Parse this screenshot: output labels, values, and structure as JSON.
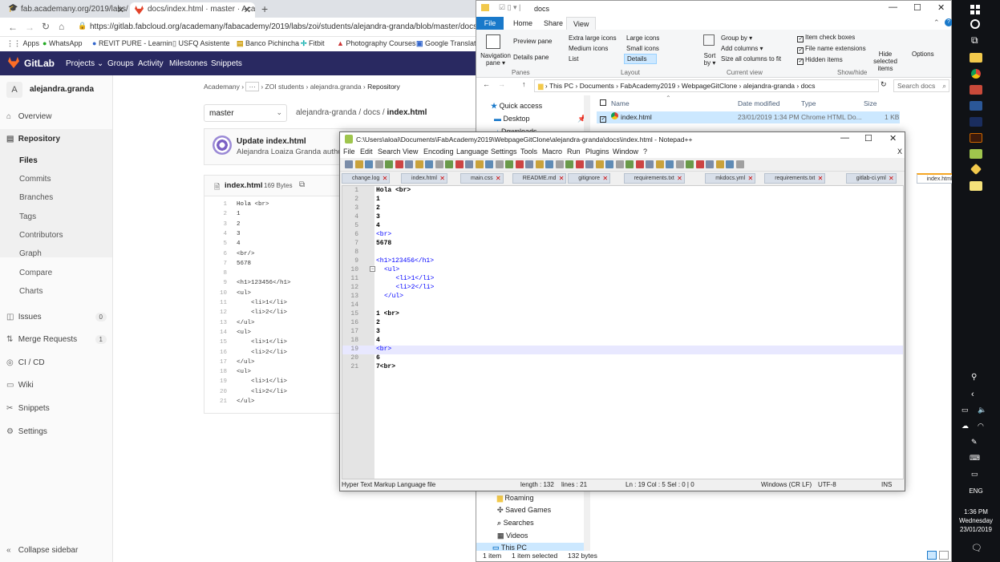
{
  "chrome": {
    "tabs": [
      {
        "title": "fab.academany.org/2019/labs/zo"
      },
      {
        "title": "docs/index.html · master · Acade"
      }
    ],
    "url": "https://gitlab.fabcloud.org/academany/fabacademy/2019/labs/zoi/students/alejandra-granda/blob/master/docs/index.h",
    "bookmarks": [
      "Apps",
      "WhatsApp",
      "REVIT PURE - Learnin",
      "USFQ Asistente",
      "Banco Pichincha",
      "Fitbit",
      "Photography Courses",
      "Google Translate"
    ]
  },
  "gitlab": {
    "logo": "GitLab",
    "nav": [
      "Projects ⌄",
      "Groups",
      "Activity",
      "Milestones",
      "Snippets"
    ],
    "user": "alejandra.granda",
    "avatar": "A",
    "sidebar": {
      "items": [
        {
          "label": "Overview",
          "icon": "⌂"
        },
        {
          "label": "Repository",
          "icon": "▤"
        },
        {
          "label": "Issues",
          "icon": "◫",
          "badge": "0"
        },
        {
          "label": "Merge Requests",
          "icon": "⇅",
          "badge": "1"
        },
        {
          "label": "CI / CD",
          "icon": "◎"
        },
        {
          "label": "Wiki",
          "icon": "▭"
        },
        {
          "label": "Snippets",
          "icon": "✂"
        },
        {
          "label": "Settings",
          "icon": "⚙"
        }
      ],
      "repo_sub": [
        "Files",
        "Commits",
        "Branches",
        "Tags",
        "Contributors",
        "Graph",
        "Compare",
        "Charts"
      ],
      "collapse": "Collapse sidebar"
    },
    "breadcrumb": [
      "Academany",
      "···",
      "ZOI students",
      "alejandra.granda",
      "Repository"
    ],
    "branch": "master",
    "path": [
      "alejandra-granda",
      "docs",
      "index.html"
    ],
    "commit_title": "Update index.html",
    "commit_author": "Alejandra Loaiza Granda author",
    "file_name": "index.html",
    "file_size": "169 Bytes",
    "code": [
      "Hola <br>",
      "1",
      "2",
      "3",
      "4",
      "<br/>",
      "5678",
      "",
      "<h1>123456</h1>",
      "<ul>",
      "    <li>1</li>",
      "    <li>2</li>",
      "</ul>",
      "<ul>",
      "    <li>1</li>",
      "    <li>2</li>",
      "</ul>",
      "<ul>",
      "    <li>1</li>",
      "    <li>2</li>",
      "</ul>"
    ]
  },
  "explorer": {
    "title": "docs",
    "tabs": [
      "File",
      "Home",
      "Share",
      "View"
    ],
    "ribbon": {
      "panes": [
        "Navigation pane ▾",
        "Preview pane",
        "Details pane"
      ],
      "layout": [
        "Extra large icons",
        "Large icons",
        "Medium icons",
        "Small icons",
        "List",
        "Details"
      ],
      "sort": "Sort by ▾",
      "view": [
        "Group by ▾",
        "Add columns ▾",
        "Size all columns to fit"
      ],
      "checks": [
        "Item check boxes",
        "File name extensions",
        "Hidden items"
      ],
      "hide": "Hide selected items",
      "options": "Options",
      "groups": [
        "Panes",
        "Layout",
        "Current view",
        "Show/hide"
      ]
    },
    "crumbs": [
      "This PC",
      "Documents",
      "FabAcademy2019",
      "WebpageGitClone",
      "alejandra-granda",
      "docs"
    ],
    "search": "Search docs",
    "columns": [
      "Name",
      "Date modified",
      "Type",
      "Size"
    ],
    "file": {
      "name": "index.html",
      "date": "23/01/2019 1:34 PM",
      "type": "Chrome HTML Do...",
      "size": "1 KB"
    },
    "nav": [
      "Quick access",
      "Desktop",
      "Downloads",
      "Roaming",
      "Saved Games",
      "Searches",
      "Videos",
      "This PC"
    ],
    "status": [
      "1 item",
      "1 item selected",
      "132 bytes"
    ]
  },
  "npp": {
    "title": "C:\\Users\\aloai\\Documents\\FabAcademy2019\\WebpageGitClone\\alejandra-granda\\docs\\index.html - Notepad++",
    "menu": [
      "File",
      "Edit",
      "Search",
      "View",
      "Encoding",
      "Language",
      "Settings",
      "Tools",
      "Macro",
      "Run",
      "Plugins",
      "Window",
      "?"
    ],
    "tabs": [
      "change.log",
      "index.html",
      "main.css",
      "README.md",
      "gitignore",
      "requirements.txt",
      "mkdocs.yml",
      "requirements.txt",
      "gitlab-ci.yml",
      "index.html"
    ],
    "lines": [
      "Hola <br>",
      "1",
      "2",
      "3",
      "4",
      "<br>",
      "5678",
      "",
      "<h1>123456</h1>",
      "<ul>",
      "   <li>1</li>",
      "   <li>2</li>",
      "</ul>",
      "",
      "1 <br>",
      "2",
      "3",
      "4",
      "<br>",
      "6",
      "7<br>"
    ],
    "status": {
      "type": "Hyper Text Markup Language file",
      "length": "length : 132",
      "lines": "lines : 21",
      "pos": "Ln : 19   Col : 5   Sel : 0 | 0",
      "eol": "Windows (CR LF)",
      "enc": "UTF-8",
      "ins": "INS"
    }
  },
  "taskbar": {
    "lang": "ENG",
    "time": "1:36 PM",
    "day": "Wednesday",
    "date": "23/01/2019"
  }
}
